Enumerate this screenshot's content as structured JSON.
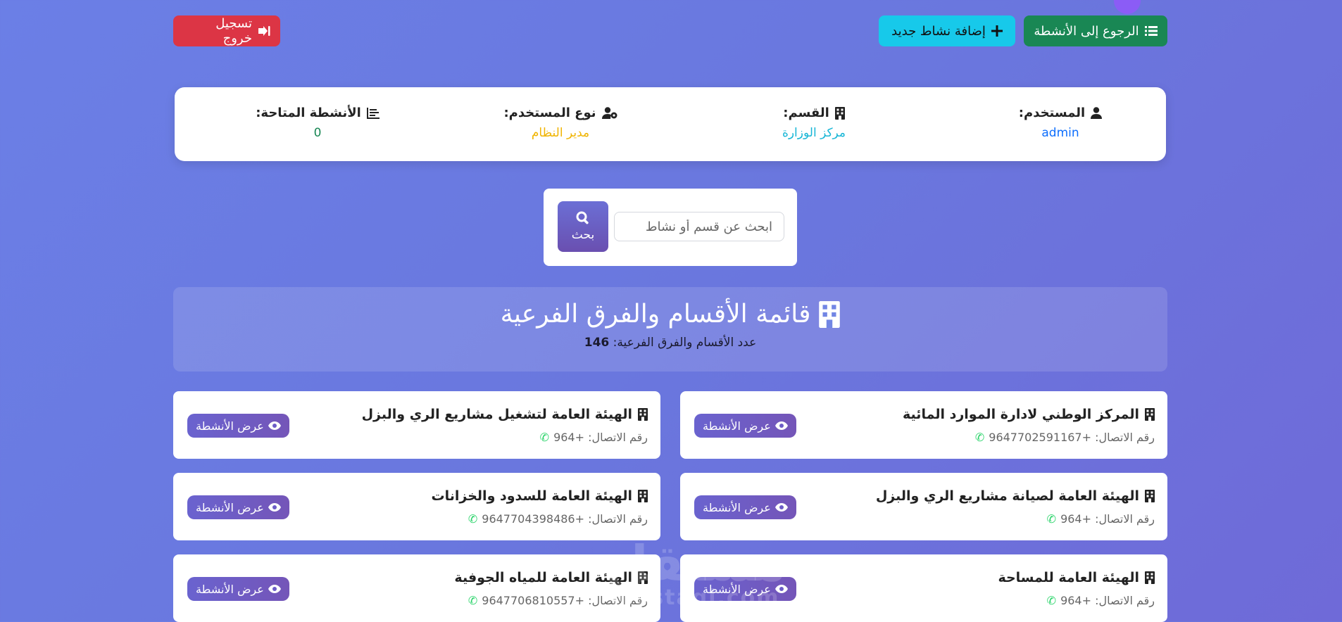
{
  "topbar": {
    "back_label": "الرجوع إلى الأنشطة",
    "add_label": "إضافة نشاط جديد",
    "logout_label": "تسجيل خروج"
  },
  "info": {
    "user_label": "المستخدم:",
    "user_value": "admin",
    "dept_label": "القسم:",
    "dept_value": "مركز الوزارة",
    "type_label": "نوع المستخدم:",
    "type_value": "مدير النظام",
    "activities_label": "الأنشطة المتاحة:",
    "activities_value": "0",
    "colors": {
      "user": "#0d6efd",
      "dept": "#17b6d6",
      "type": "#f0b400",
      "activities": "#198754"
    }
  },
  "search": {
    "placeholder": "ابحث عن قسم أو نشاط",
    "button_label": "بحث"
  },
  "banner": {
    "title": "قائمة الأقسام والفرق الفرعية",
    "count_label": "عدد الأقسام والفرق الفرعية:",
    "count_value": "146"
  },
  "cards": [
    {
      "name": "المركز الوطني لادارة الموارد المائية",
      "phone": "رقم الاتصال: +9647702591167",
      "button": "عرض الأنشطة"
    },
    {
      "name": "الهيئة العامة لتشغيل مشاريع الري والبزل",
      "phone": "رقم الاتصال: +964",
      "button": "عرض الأنشطة"
    },
    {
      "name": "الهيئة العامة لصيانة مشاريع الري والبزل",
      "phone": "رقم الاتصال: +964",
      "button": "عرض الأنشطة"
    },
    {
      "name": "الهيئة العامة للسدود والخزانات",
      "phone": "رقم الاتصال: +9647704398486",
      "button": "عرض الأنشطة"
    },
    {
      "name": "الهيئة العامة للمساحة",
      "phone": "رقم الاتصال: +964",
      "button": "عرض الأنشطة"
    },
    {
      "name": "الهيئة العامة للمياه الجوفية",
      "phone": "رقم الاتصال: +9647706810557",
      "button": "عرض الأنشطة"
    }
  ],
  "watermark": {
    "text": "مستقل",
    "sub": "mostaql.com"
  }
}
